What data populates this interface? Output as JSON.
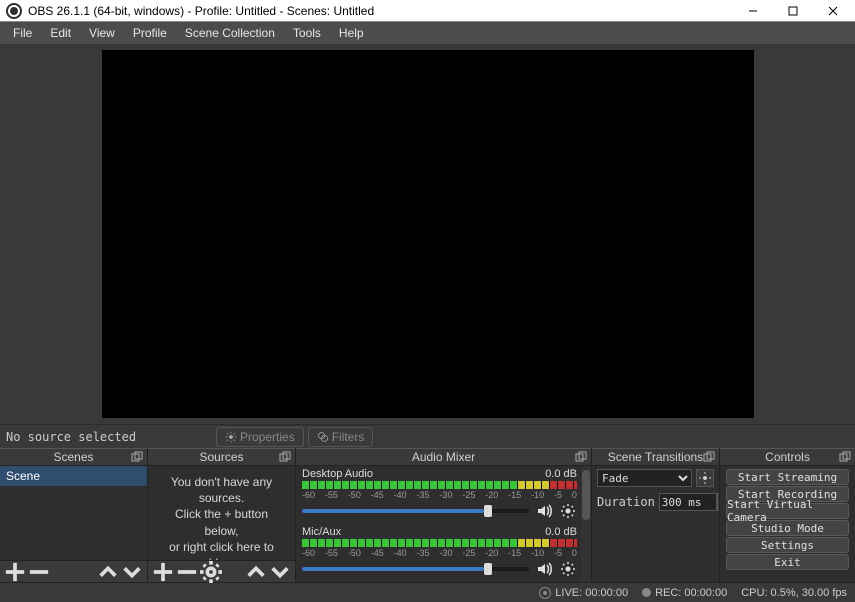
{
  "window": {
    "title": "OBS 26.1.1 (64-bit, windows) - Profile: Untitled - Scenes: Untitled"
  },
  "menubar": [
    "File",
    "Edit",
    "View",
    "Profile",
    "Scene Collection",
    "Tools",
    "Help"
  ],
  "sourcebar": {
    "status": "No source selected",
    "properties": "Properties",
    "filters": "Filters"
  },
  "docks": {
    "scenes": {
      "title": "Scenes",
      "items": [
        "Scene"
      ]
    },
    "sources": {
      "title": "Sources",
      "empty1": "You don't have any sources.",
      "empty2": "Click the + button below,",
      "empty3": "or right click here to add one."
    },
    "mixer": {
      "title": "Audio Mixer",
      "scale": [
        "-60",
        "-55",
        "-50",
        "-45",
        "-40",
        "-35",
        "-30",
        "-25",
        "-20",
        "-15",
        "-10",
        "-5",
        "0"
      ],
      "channels": [
        {
          "name": "Desktop Audio",
          "level": "0.0 dB",
          "slider_pct": 80
        },
        {
          "name": "Mic/Aux",
          "level": "0.0 dB",
          "slider_pct": 80
        }
      ]
    },
    "transitions": {
      "title": "Scene Transitions",
      "type": "Fade",
      "duration_label": "Duration",
      "duration": "300 ms"
    },
    "controls": {
      "title": "Controls",
      "buttons": [
        "Start Streaming",
        "Start Recording",
        "Start Virtual Camera",
        "Studio Mode",
        "Settings",
        "Exit"
      ]
    }
  },
  "statusbar": {
    "live": "LIVE: 00:00:00",
    "rec": "REC: 00:00:00",
    "cpu": "CPU: 0.5%, 30.00 fps"
  }
}
